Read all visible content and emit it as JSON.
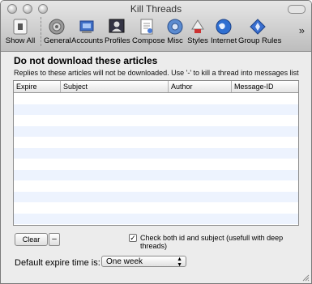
{
  "window": {
    "title": "Kill Threads"
  },
  "toolbar": {
    "items": [
      {
        "label": "Show All",
        "icon": "show-all-icon"
      },
      {
        "label": "General",
        "icon": "gear-icon"
      },
      {
        "label": "Accounts",
        "icon": "accounts-icon"
      },
      {
        "label": "Profiles",
        "icon": "profiles-icon"
      },
      {
        "label": "Compose",
        "icon": "compose-icon"
      },
      {
        "label": "Misc",
        "icon": "misc-gear-icon"
      },
      {
        "label": "Styles",
        "icon": "styles-icon"
      },
      {
        "label": "Internet",
        "icon": "globe-icon"
      },
      {
        "label": "Group Rules",
        "icon": "group-rules-icon"
      }
    ],
    "overflow": "»"
  },
  "content": {
    "heading": "Do not download these articles",
    "subtitle": "Replies to these articles will not be downloaded. Use '-' to kill a thread into messages list"
  },
  "table": {
    "columns": [
      "Expire",
      "Subject",
      "Author",
      "Message-ID"
    ],
    "rows": []
  },
  "controls": {
    "clear_label": "Clear",
    "remove_label": "–",
    "check_both_label": "Check both id and subject (usefull with deep threads)",
    "check_both_checked": true,
    "check_mark": "✓",
    "expire_label": "Default expire time is:",
    "expire_value": "One week"
  },
  "colors": {
    "row_stripe": "#edf3fe",
    "toolbar_top": "#e6e6e6",
    "toolbar_bottom": "#bdbdbd"
  }
}
